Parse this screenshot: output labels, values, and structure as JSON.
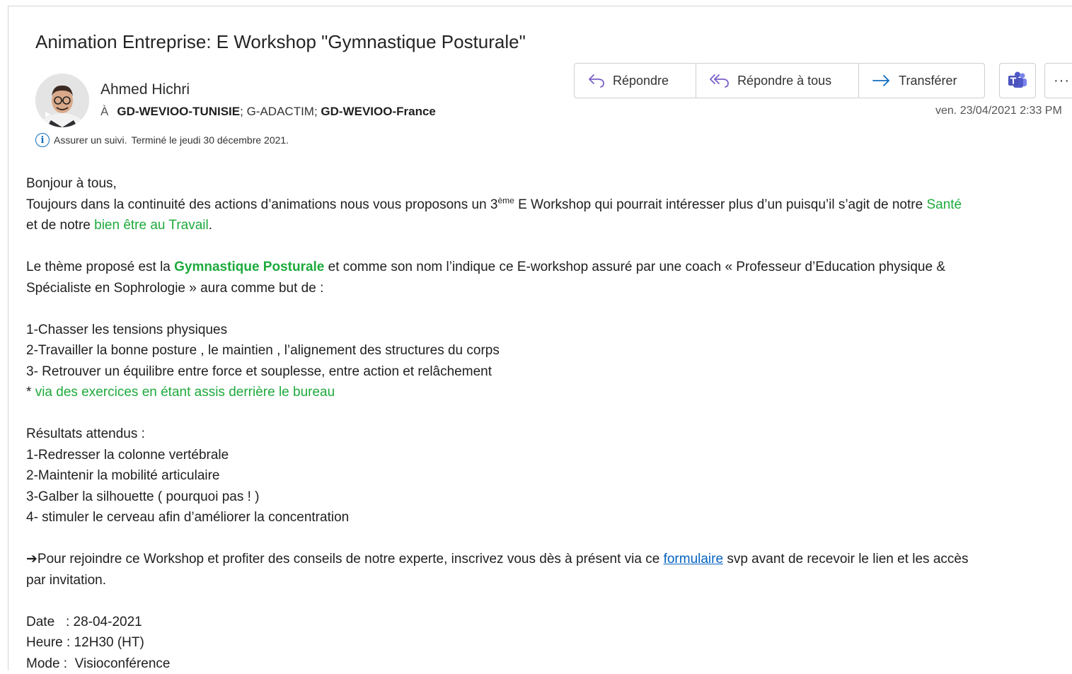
{
  "email": {
    "subject": "Animation Entreprise: E Workshop \"Gymnastique Posturale\"",
    "sender": "Ahmed Hichri",
    "to_label": "À",
    "recipients": [
      {
        "name": "GD-WEVIOO-TUNISIE",
        "bold": true
      },
      {
        "name": "G-ADACTIM",
        "bold": false
      },
      {
        "name": "GD-WEVIOO-France",
        "bold": true
      }
    ],
    "recipient_sep": "; ",
    "followup_status": "Assurer un suivi.",
    "followup_due": "Terminé le jeudi 30 décembre 2021.",
    "date": "ven. 23/04/2021 2:33 PM"
  },
  "actions": {
    "reply": "Répondre",
    "reply_all": "Répondre à tous",
    "forward": "Transférer",
    "more": "···"
  },
  "body": {
    "greeting": "Bonjour à tous,",
    "p1_a": "Toujours dans la continuité des actions d’animations nous vous proposons un 3",
    "p1_sup": "ème",
    "p1_b": " E Workshop qui pourrait intéresser plus d’un puisqu’il s’agit de notre ",
    "p1_green1": "Santé",
    "p1_c": "et de notre ",
    "p1_green2": "bien être au Travail",
    "p1_d": ".",
    "p2_a": "Le thème proposé est la ",
    "p2_green": "Gymnastique Posturale",
    "p2_b": " et comme son nom l’indique ce E-workshop assuré par une coach « Professeur d’Education physique &",
    "p2_c": "Spécialiste en Sophrologie » aura comme but de  :",
    "goals": [
      "1-Chasser les tensions physiques",
      "2-Travailler la bonne posture , le maintien , l’alignement des structures du corps",
      "3- Retrouver un équilibre entre force et souplesse, entre action et relâchement"
    ],
    "goal_note_star": "* ",
    "goal_note": "via des exercices en étant assis derrière le bureau",
    "results_title": "Résultats attendus :",
    "results": [
      "1-Redresser la colonne vertébrale",
      "2-Maintenir la mobilité articulaire",
      "3-Galber la silhouette ( pourquoi pas ! )",
      "4- stimuler le cerveau afin d’améliorer la concentration"
    ],
    "cta_arrow": "➔",
    "cta_a": "Pour rejoindre ce Workshop et profiter des conseils de notre experte, inscrivez vous  dès à présent via ce ",
    "cta_link": "formulaire",
    "cta_b": " svp avant de recevoir le lien et les accès",
    "cta_c": "par invitation.",
    "date_line": "Date   : 28-04-2021",
    "time_line": "Heure : 12H30 (HT)",
    "mode_line": "Mode :  Visioconférence"
  },
  "colors": {
    "accent_green": "#1eaa3c",
    "link_blue": "#0563c1",
    "icon_purple": "#7b5fc7",
    "icon_blue": "#0f6cbd"
  }
}
